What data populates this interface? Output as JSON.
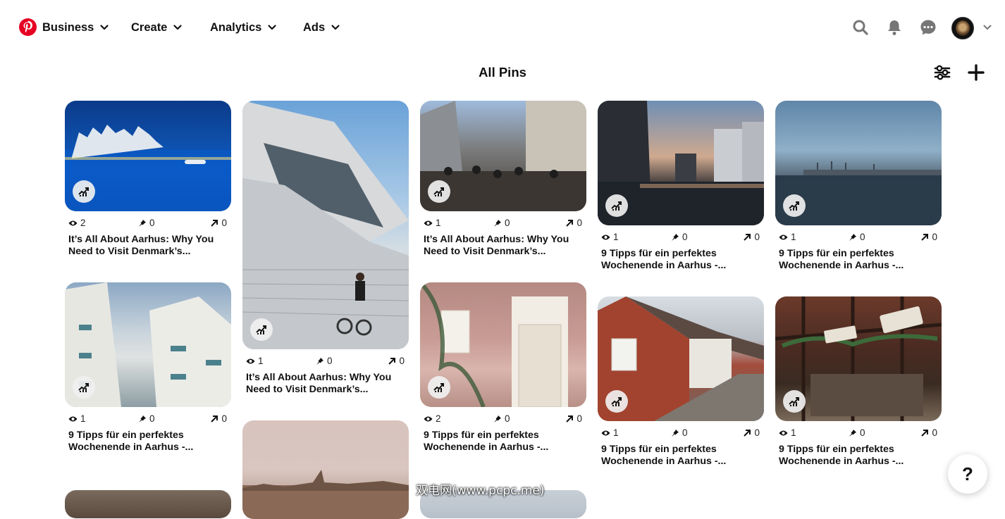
{
  "nav": {
    "items": [
      {
        "label": "Business"
      },
      {
        "label": "Create"
      },
      {
        "label": "Analytics"
      },
      {
        "label": "Ads"
      }
    ]
  },
  "page": {
    "title": "All Pins"
  },
  "icons": {
    "logo": "pinterest-logo",
    "search": "search-icon",
    "notifications": "bell-icon",
    "messages": "chat-icon",
    "account_menu": "chevron-down-icon",
    "filter": "sliders-icon",
    "add": "plus-icon",
    "pin_stats": "analytics-icon",
    "views": "eye-icon",
    "saves": "pin-icon",
    "clicks": "arrow-up-right-icon"
  },
  "colors": {
    "brand": "#e60023",
    "text": "#111111",
    "background": "#ffffff"
  },
  "pins": [
    {
      "views": "2",
      "saves": "0",
      "clicks": "0",
      "title": "It’s All About Aarhus: Why You Need to Visit Denmark’s..."
    },
    {
      "views": "1",
      "saves": "0",
      "clicks": "0",
      "title": "9 Tipps für ein perfektes Wochenende in Aarhus -..."
    },
    {
      "views": "1",
      "saves": "0",
      "clicks": "0",
      "title": "It’s All About Aarhus: Why You Need to Visit Denmark’s..."
    },
    {
      "views": "1",
      "saves": "0",
      "clicks": "0",
      "title": "It’s All About Aarhus: Why You Need to Visit Denmark’s..."
    },
    {
      "views": "2",
      "saves": "0",
      "clicks": "0",
      "title": "9 Tipps für ein perfektes Wochenende in Aarhus -..."
    },
    {
      "views": "1",
      "saves": "0",
      "clicks": "0",
      "title": "9 Tipps für ein perfektes Wochenende in Aarhus -..."
    },
    {
      "views": "1",
      "saves": "0",
      "clicks": "0",
      "title": "9 Tipps für ein perfektes Wochenende in Aarhus -..."
    },
    {
      "views": "1",
      "saves": "0",
      "clicks": "0",
      "title": "9 Tipps für ein perfektes Wochenende in Aarhus -..."
    },
    {
      "views": "1",
      "saves": "0",
      "clicks": "0",
      "title": "9 Tipps für ein perfektes Wochenende in Aarhus -..."
    }
  ],
  "help": {
    "label": "?"
  },
  "watermark": {
    "text": "双电网(www.pcpc.me)"
  }
}
